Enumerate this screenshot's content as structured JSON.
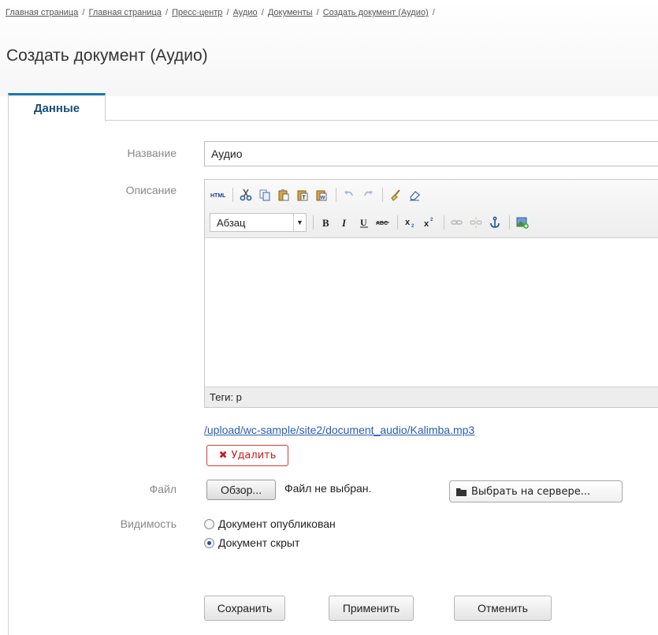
{
  "breadcrumb": {
    "items": [
      "Главная страница",
      "Главная страница",
      "Пресс-центр",
      "Аудио",
      "Документы",
      "Создать документ (Аудио)"
    ],
    "separator": "/"
  },
  "page_title": "Создать документ (Аудио)",
  "tabs": [
    {
      "label": "Данные",
      "active": true
    }
  ],
  "form": {
    "name_label": "Название",
    "name_value": "Аудио",
    "description_label": "Описание",
    "editor": {
      "format_value": "Абзац",
      "status": "Теги: p",
      "toolbar_row1": [
        "html-icon",
        "cut-icon",
        "copy-icon",
        "paste-icon",
        "paste-text-icon",
        "paste-word-icon",
        "undo-icon",
        "redo-icon",
        "clean-icon",
        "eraser-icon"
      ],
      "toolbar_row2": [
        "format-select",
        "bold-icon",
        "italic-icon",
        "underline-icon",
        "strikethrough-icon",
        "subscript-icon",
        "superscript-icon",
        "link-icon",
        "unlink-icon",
        "anchor-icon",
        "image-icon"
      ]
    },
    "file_link": "/upload/wc-sample/site2/document_audio/Kalimba.mp3",
    "delete_label": "Удалить",
    "file_label": "Файл",
    "browse_label": "Обзор...",
    "no_file_text": "Файл не выбран.",
    "server_label": "Выбрать на сервере...",
    "visibility_label": "Видимость",
    "visibility_options": [
      {
        "label": "Документ опубликован",
        "checked": false
      },
      {
        "label": "Документ скрыт",
        "checked": true
      }
    ]
  },
  "actions": {
    "save": "Сохранить",
    "apply": "Применить",
    "cancel": "Отменить"
  },
  "colors": {
    "tab_accent": "#1e76a8",
    "link": "#2a5db0",
    "delete": "#c81e1e"
  }
}
